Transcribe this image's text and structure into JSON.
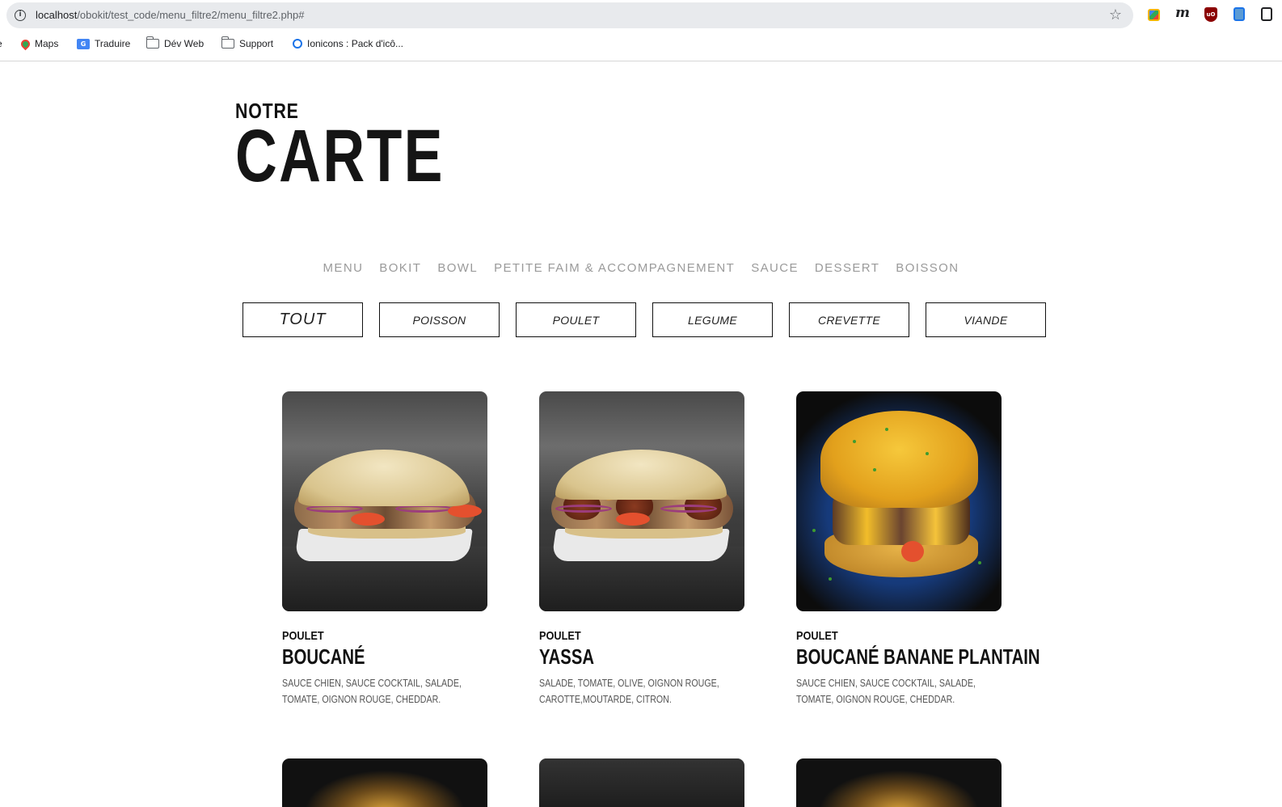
{
  "browser": {
    "url_host": "localhost",
    "url_path": "/obokit/test_code/menu_filtre2/menu_filtre2.php#",
    "bookmarks": [
      {
        "label": "e",
        "icon": "edge-icon"
      },
      {
        "label": "Maps",
        "icon": "maps-icon"
      },
      {
        "label": "Traduire",
        "icon": "translate-icon"
      },
      {
        "label": "Dév Web",
        "icon": "folder-icon"
      },
      {
        "label": "Support",
        "icon": "folder-icon"
      },
      {
        "label": "Ionicons : Pack d'icô...",
        "icon": "ionicons-icon"
      }
    ],
    "extensions": [
      {
        "name": "color-picker-extension-icon"
      },
      {
        "name": "m",
        "icon": "m-extension-icon"
      },
      {
        "name": "ublock-icon",
        "text": "uO"
      },
      {
        "name": "tab-extension-icon"
      },
      {
        "name": "extension-icon"
      }
    ]
  },
  "header": {
    "small": "NOTRE",
    "big": "CARTE"
  },
  "category_nav": [
    "MENU",
    "BOKIT",
    "BOWL",
    "PETITE FAIM & ACCOMPAGNEMENT",
    "SAUCE",
    "DESSERT",
    "BOISSON"
  ],
  "filters": [
    {
      "label": "TOUT",
      "active": true
    },
    {
      "label": "POISSON",
      "active": false
    },
    {
      "label": "POULET",
      "active": false
    },
    {
      "label": "LEGUME",
      "active": false
    },
    {
      "label": "CREVETTE",
      "active": false
    },
    {
      "label": "VIANDE",
      "active": false
    }
  ],
  "products": [
    {
      "category": "POULET",
      "title": "BOUCANÉ",
      "description": "SAUCE CHIEN, SAUCE COCKTAIL, SALADE, TOMATE, OIGNON ROUGE, CHEDDAR.",
      "image": "bokit-boucane-image"
    },
    {
      "category": "POULET",
      "title": "YASSA",
      "description": "SALADE, TOMATE, OLIVE, OIGNON ROUGE, CAROTTE,MOUTARDE, CITRON.",
      "image": "bokit-yassa-image"
    },
    {
      "category": "POULET",
      "title": "BOUCANÉ BANANE PLANTAIN",
      "description": "SAUCE CHIEN, SAUCE COCKTAIL, SALADE, TOMATE, OIGNON ROUGE, CHEDDAR.",
      "image": "bokit-boucane-banane-plantain-image"
    }
  ]
}
